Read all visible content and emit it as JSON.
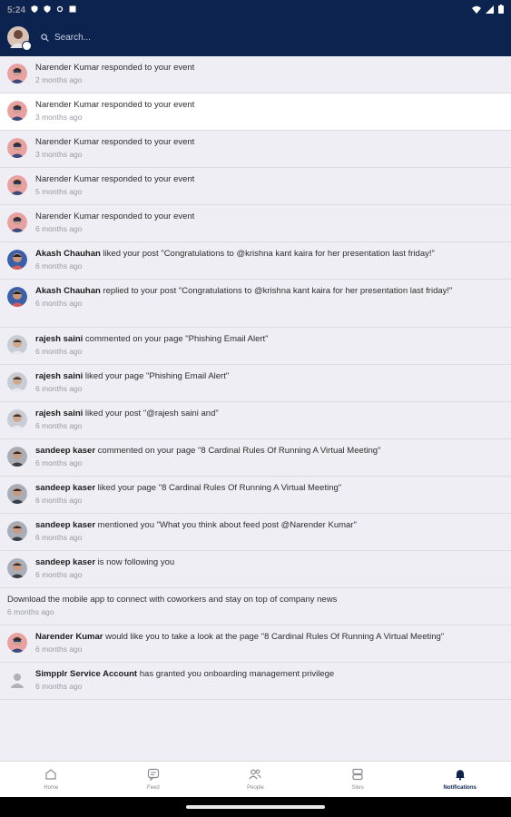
{
  "status": {
    "time": "5:24"
  },
  "header": {
    "search_placeholder": "Search..."
  },
  "notifications": [
    {
      "avatar": "narender",
      "actor": "",
      "text": "Narender Kumar responded to your event",
      "time": "2 months ago",
      "highlight": false
    },
    {
      "avatar": "narender",
      "actor": "",
      "text": "Narender Kumar responded to your event",
      "time": "3 months ago",
      "highlight": true
    },
    {
      "avatar": "narender",
      "actor": "",
      "text": "Narender Kumar responded to your event",
      "time": "3 months ago",
      "highlight": false
    },
    {
      "avatar": "narender",
      "actor": "",
      "text": "Narender Kumar responded to your event",
      "time": "5 months ago",
      "highlight": false
    },
    {
      "avatar": "narender",
      "actor": "",
      "text": "Narender Kumar responded to your event",
      "time": "6 months ago",
      "highlight": false
    },
    {
      "avatar": "akash",
      "actor": "Akash Chauhan",
      "text": " liked your post \"Congratulations to @krishna kant kaira for her presentation last friday!\"",
      "time": "6 months ago",
      "highlight": false
    },
    {
      "avatar": "akash",
      "actor": "Akash Chauhan",
      "text": " replied to your post \"Congratulations to @krishna kant kaira for her presentation last friday!\"",
      "time": "6 months ago",
      "highlight": false
    },
    {
      "avatar": "rajesh",
      "actor": "rajesh saini",
      "text": " commented on your page \"Phishing Email Alert\"",
      "time": "6 months ago",
      "highlight": false
    },
    {
      "avatar": "rajesh",
      "actor": "rajesh saini",
      "text": " liked your page \"Phishing Email Alert\"",
      "time": "6 months ago",
      "highlight": false
    },
    {
      "avatar": "rajesh",
      "actor": "rajesh saini",
      "text": " liked your post \"@rajesh saini and\"",
      "time": "6 months ago",
      "highlight": false
    },
    {
      "avatar": "sandeep",
      "actor": "sandeep kaser",
      "text": " commented on your page \"8 Cardinal Rules Of Running A Virtual Meeting\"",
      "time": "6 months ago",
      "highlight": false
    },
    {
      "avatar": "sandeep",
      "actor": "sandeep kaser",
      "text": " liked your page \"8 Cardinal Rules Of Running A Virtual Meeting\"",
      "time": "6 months ago",
      "highlight": false
    },
    {
      "avatar": "sandeep",
      "actor": "sandeep kaser",
      "text": " mentioned you \"What you think about feed post @Narender Kumar\"",
      "time": "6 months ago",
      "highlight": false
    },
    {
      "avatar": "sandeep",
      "actor": "sandeep kaser",
      "text": " is now following you",
      "time": "6 months ago",
      "highlight": false
    },
    {
      "avatar": "none",
      "actor": "",
      "text": "Download the mobile app to connect with coworkers and stay on top of company news",
      "time": "6 months ago",
      "highlight": false
    },
    {
      "avatar": "narender",
      "actor": "Narender Kumar",
      "text": " would like you to take a look at the page \"8 Cardinal Rules Of Running A Virtual Meeting\"",
      "time": "6 months ago",
      "highlight": false
    },
    {
      "avatar": "service",
      "actor": "Simpplr Service Account",
      "text": " has granted you onboarding management privilege",
      "time": "6 months ago",
      "highlight": false
    }
  ],
  "nav": [
    {
      "id": "home",
      "label": "Home",
      "icon": "home-icon",
      "active": false
    },
    {
      "id": "feed",
      "label": "Feed",
      "icon": "feed-icon",
      "active": false
    },
    {
      "id": "people",
      "label": "People",
      "icon": "people-icon",
      "active": false
    },
    {
      "id": "sites",
      "label": "Sites",
      "icon": "sites-icon",
      "active": false
    },
    {
      "id": "notifications",
      "label": "Notifications",
      "icon": "bell-icon",
      "active": true
    }
  ],
  "colors": {
    "header": "#0c2350",
    "background": "#eeeef4",
    "highlight": "#ffffff"
  }
}
